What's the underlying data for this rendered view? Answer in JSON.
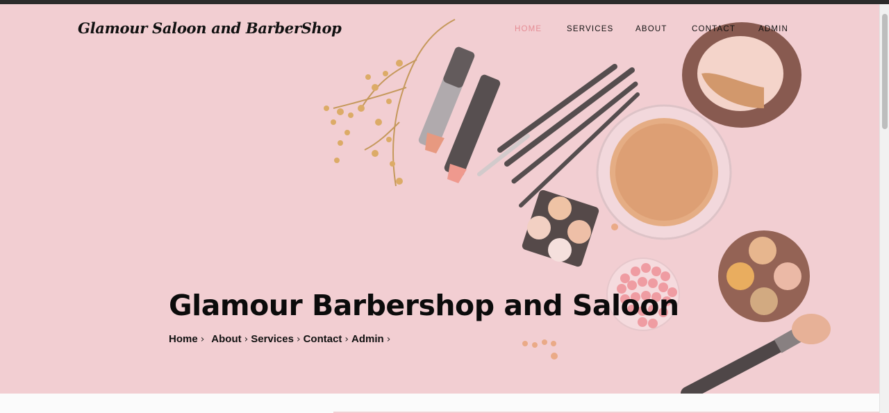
{
  "brand": {
    "name": "Glamour Saloon and BarberShop"
  },
  "nav": {
    "items": [
      {
        "label": "HOME",
        "active": true
      },
      {
        "label": "SERVICES",
        "active": false
      },
      {
        "label": "ABOUT",
        "active": false
      },
      {
        "label": "CONTACT",
        "active": false
      },
      {
        "label": "ADMIN",
        "active": false
      }
    ]
  },
  "hero": {
    "title": "Glamour Barbershop and Saloon",
    "breadcrumbs": [
      "Home",
      "About",
      "Services",
      "Contact",
      "Admin"
    ],
    "separator_icon": "chevron-right-icon"
  },
  "colors": {
    "hero_background": "#f2cfd3",
    "nav_active": "#e58d95",
    "text": "#111111"
  }
}
